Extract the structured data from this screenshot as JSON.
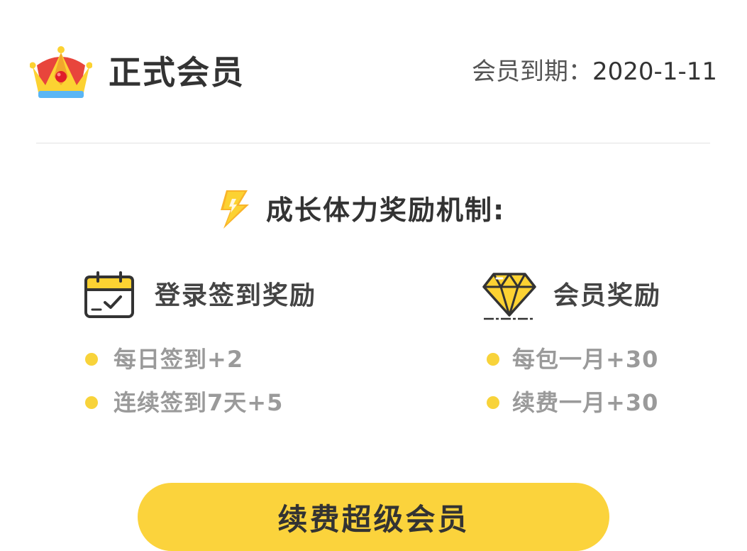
{
  "header": {
    "title": "正式会员",
    "expiry_label": "会员到期：",
    "expiry_date": "2020-1-11",
    "crown_icon": "crown-icon"
  },
  "section": {
    "title": "成长体力奖励机制:",
    "icon": "lightning-icon"
  },
  "login_rewards": {
    "title": "登录签到奖励",
    "icon": "calendar-check-icon",
    "items": [
      "每日签到+2",
      "连续签到7天+5"
    ]
  },
  "member_rewards": {
    "title": "会员奖励",
    "icon": "diamond-icon",
    "items": [
      "每包一月+30",
      "续费一月+30"
    ]
  },
  "button": {
    "label": "续费超级会员"
  },
  "colors": {
    "accent": "#fbd33c",
    "bullet": "#f8d33a",
    "text_dark": "#333333",
    "text_gray": "#9a9a9a",
    "crown_red": "#e8453c",
    "crown_gold": "#fcd232",
    "crown_blue": "#5ab6f5"
  }
}
